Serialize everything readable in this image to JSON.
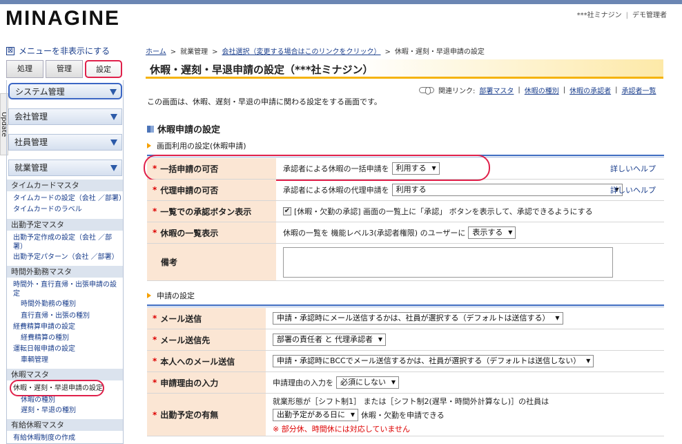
{
  "header": {
    "logo": "MINAGINE",
    "company": "***社ミナジン",
    "user": "デモ管理者"
  },
  "sidebar": {
    "toggle_label": "メニューを非表示にする",
    "toggle_icon": "collapse-box-icon",
    "tabs": [
      "処理",
      "管理",
      "設定"
    ],
    "active_tab": "設定",
    "side_tab_label": "Update",
    "groups": [
      "システム管理",
      "会社管理",
      "社員管理",
      "就業管理"
    ],
    "subgroups": [
      "タイムカードマスタ",
      "出勤予定マスタ",
      "時間外勤務マスタ",
      "休暇マスタ",
      "有給休暇マスタ"
    ],
    "links": {
      "timecard_settings": "タイムカードの設定（会社 ／部署）",
      "timecard_labels": "タイムカードのラベル",
      "schedule_create": "出勤予定作成の設定（会社 ／部",
      "schedule_create_2": "署）",
      "schedule_pattern": "出勤予定パターン（会社 ／部署）",
      "overtime_request": "時間外・直行直帰・出張申請の設",
      "overtime_request_2": "定",
      "overtime_types": "時間外勤務の種別",
      "direct_trip_types": "直行直帰・出張の種別",
      "expense_request": "経費精算申請の設定",
      "expense_types": "経費精算の種別",
      "daily_report": "運転日報申請の設定",
      "vehicle": "車輌管理",
      "leave_request": "休暇・遅刻・早退申請の設定",
      "leave_types": "休暇の種別",
      "late_early_types": "遅刻・早退の種別",
      "paid_leave_system": "有給休暇制度の作成"
    }
  },
  "breadcrumb": {
    "home": "ホーム",
    "l2": "就業管理",
    "l3": "会社選択（変更する場合はこのリンクをクリック）",
    "l4": "休暇・遅刻・早退申請の設定"
  },
  "page": {
    "title": "休暇・遅刻・早退申請の設定（***社ミナジン）",
    "related_label": "関連リンク:",
    "related_links": [
      "部署マスタ",
      "休暇の種別",
      "休暇の承認者",
      "承認者一覧"
    ],
    "intro": "この画面は、休暇、遅刻・早退の申請に関わる設定をする画面です。",
    "section_title": "休暇申請の設定",
    "subhead1": "画面利用の設定(休暇申請)",
    "subhead2": "申請の設定",
    "help_label": "詳しいヘルプ"
  },
  "settings1": [
    {
      "label": "一括申請の可否",
      "prefix": "承認者による休暇の一括申請を",
      "select": "利用する"
    },
    {
      "label": "代理申請の可否",
      "prefix": "承認者による休暇の代理申請を",
      "select": "利用する"
    },
    {
      "label": "一覧での承認ボタン表示",
      "checkbox_text": "[休暇・欠勤の承認] 画面の一覧上に「承認」 ボタンを表示して、承認できるようにする"
    },
    {
      "label": "休暇の一覧表示",
      "prefix": "休暇の一覧を 機能レベル3(承認者権限) のユーザーに",
      "select": "表示する"
    },
    {
      "label": "備考"
    }
  ],
  "settings2": [
    {
      "label": "メール送信",
      "select": "申請・承認時にメール送信するかは、社員が選択する（デフォルトは送信する）"
    },
    {
      "label": "メール送信先",
      "select": "部署の責任者 と 代理承認者"
    },
    {
      "label": "本人へのメール送信",
      "select": "申請・承認時にBCCでメール送信するかは、社員が選択する（デフォルトは送信しない）"
    },
    {
      "label": "申請理由の入力",
      "prefix": "申請理由の入力を",
      "select": "必須にしない"
    },
    {
      "label": "出勤予定の有無",
      "line1": "就業形態が［シフト制1］ または［シフト制2(遅早・時間外計算なし)］の社員は",
      "select": "出勤予定がある日に",
      "suffix": "休暇・欠勤を申請できる",
      "warning": "※ 部分休、時間休には対応していません"
    }
  ]
}
